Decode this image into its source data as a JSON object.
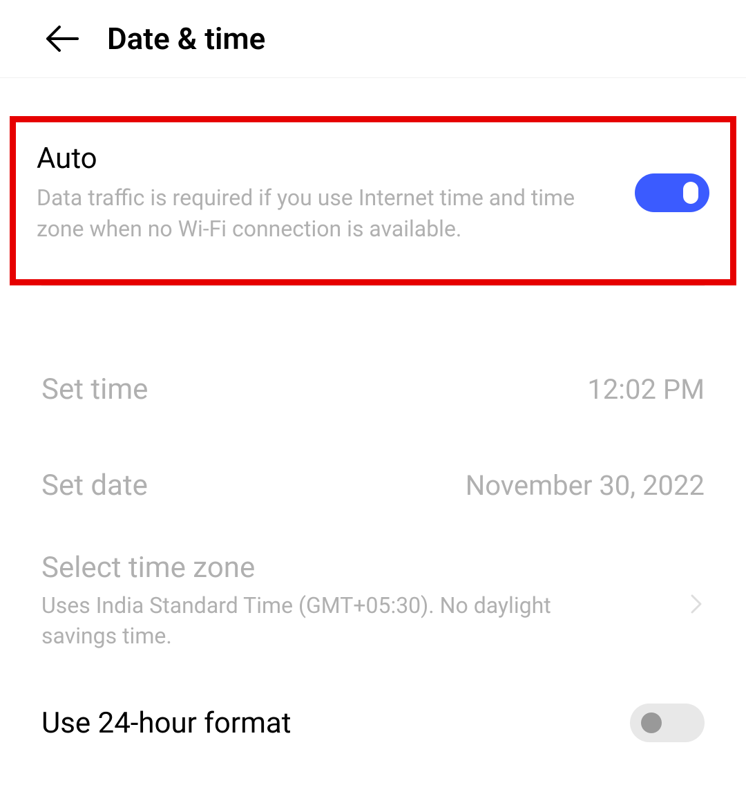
{
  "header": {
    "title": "Date & time"
  },
  "auto": {
    "title": "Auto",
    "description": "Data traffic is required if you use Internet time and time zone when no Wi-Fi connection is available.",
    "enabled": true
  },
  "setTime": {
    "label": "Set time",
    "value": "12:02 PM"
  },
  "setDate": {
    "label": "Set date",
    "value": "November 30, 2022"
  },
  "timezone": {
    "title": "Select time zone",
    "description": "Uses India Standard Time (GMT+05:30). No daylight savings time."
  },
  "format24": {
    "label": "Use 24-hour format",
    "enabled": false
  }
}
